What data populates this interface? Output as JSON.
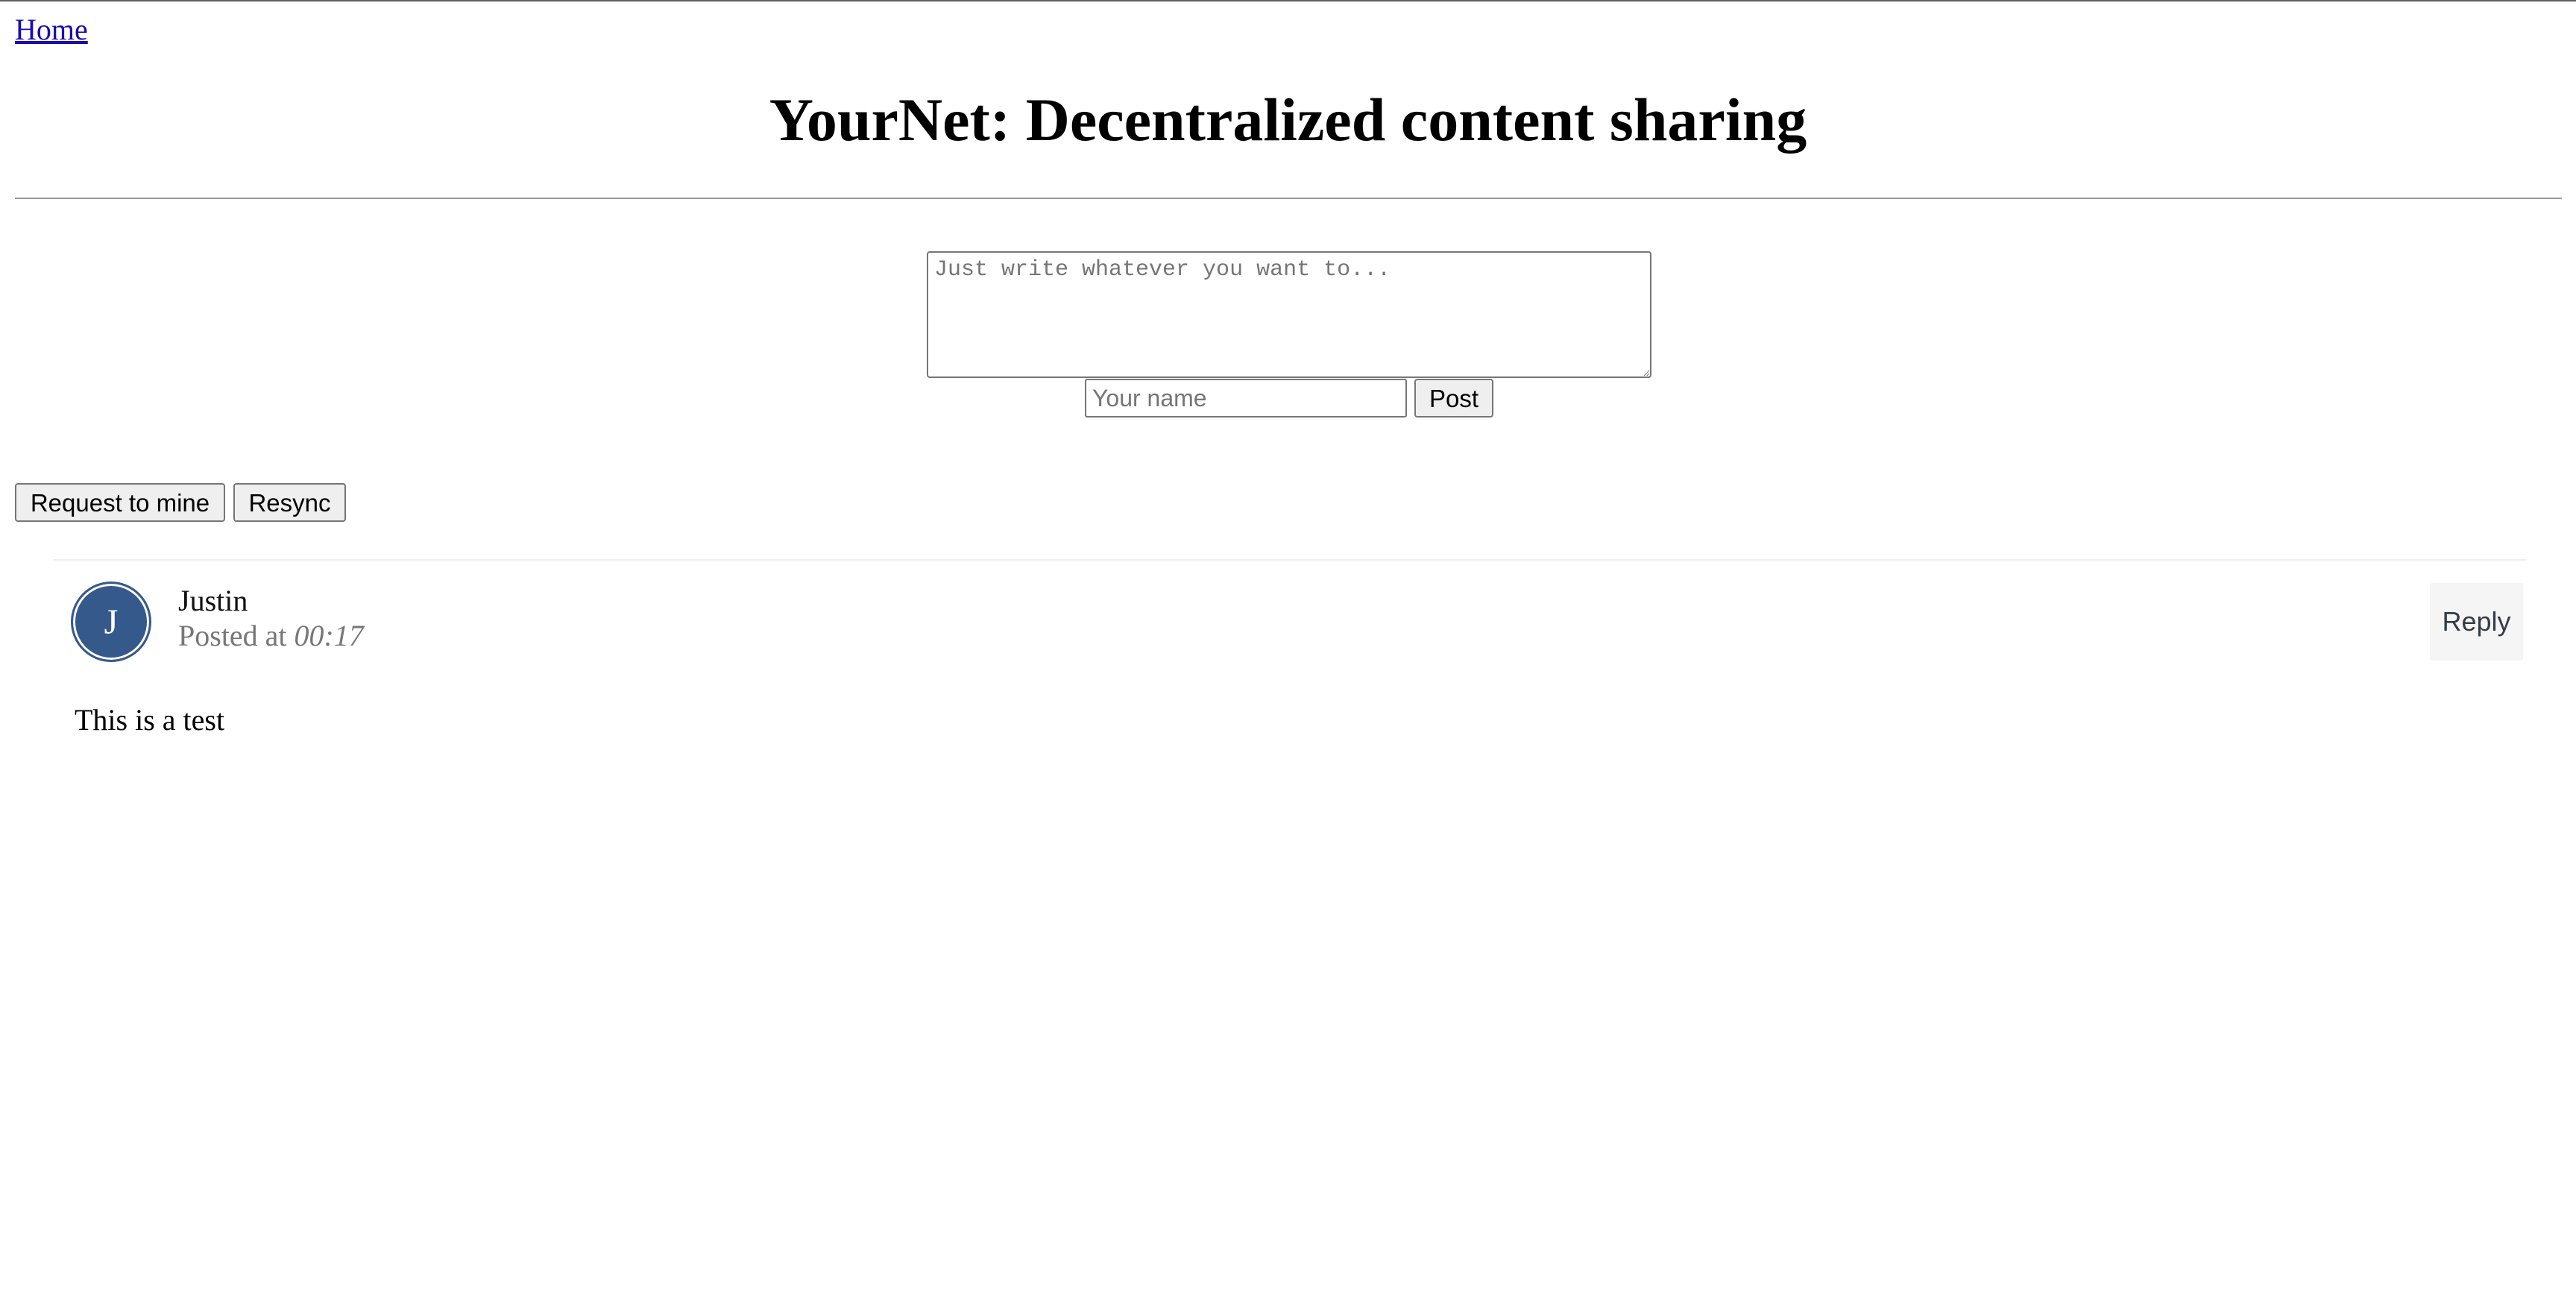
{
  "nav": {
    "home_label": "Home"
  },
  "header": {
    "title": "YourNet: Decentralized content sharing"
  },
  "composer": {
    "content_value": "",
    "content_placeholder": "Just write whatever you want to...",
    "name_value": "",
    "name_placeholder": "Your name",
    "post_label": "Post"
  },
  "actions": {
    "request_mine_label": "Request to mine",
    "resync_label": "Resync"
  },
  "feed": {
    "posts": [
      {
        "avatar_initial": "J",
        "avatar_color": "#36598b",
        "author": "Justin",
        "posted_prefix": "Posted at",
        "posted_time": "00:17",
        "reply_label": "Reply",
        "body": "This is a test"
      }
    ]
  },
  "colors": {
    "link": "#1a0dab",
    "button_bg": "#efefef",
    "muted_text": "#777777"
  }
}
